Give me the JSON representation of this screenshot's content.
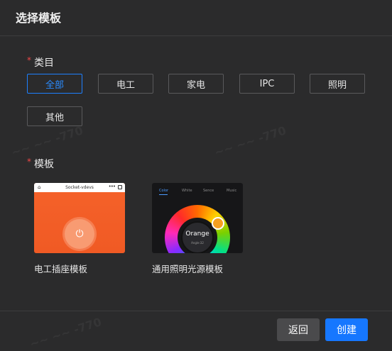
{
  "dialog": {
    "title": "选择模板"
  },
  "category": {
    "required_mark": "*",
    "label": "类目",
    "options": [
      "全部",
      "电工",
      "家电",
      "IPC",
      "照明",
      "其他"
    ],
    "selected": "全部"
  },
  "template_section": {
    "required_mark": "*",
    "label": "模板",
    "items": [
      {
        "name": "电工插座模板",
        "preview": {
          "header_title": "Socket-vdevs",
          "icon": "power-icon"
        }
      },
      {
        "name": "通用照明光源模板",
        "preview": {
          "tabs": [
            "Color",
            "White",
            "Sence",
            "Music"
          ],
          "active_tab": "Color",
          "color_label": "Orange",
          "angle_label": "Angle:32"
        }
      }
    ]
  },
  "footer": {
    "back_label": "返回",
    "create_label": "创建"
  },
  "colors": {
    "accent": "#1677ff",
    "required": "#f04848",
    "background": "#2b2b2c"
  }
}
